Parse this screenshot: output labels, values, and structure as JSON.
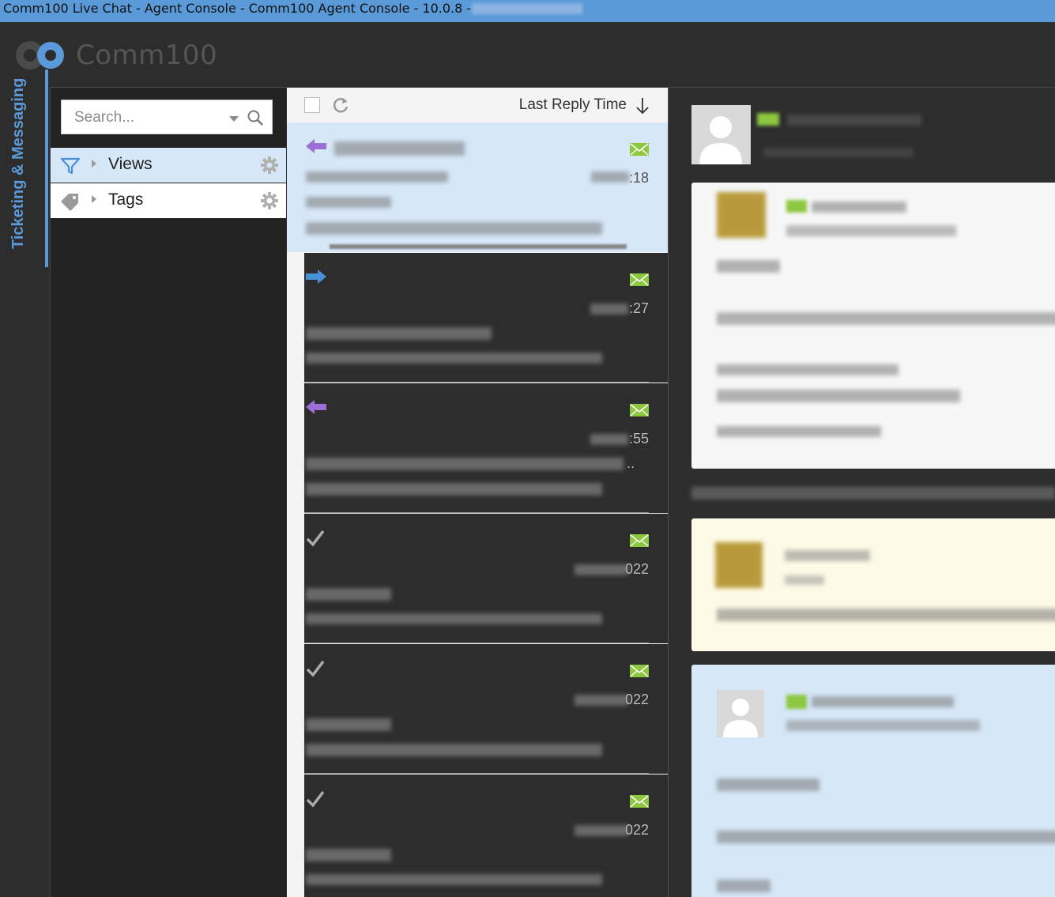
{
  "window": {
    "title": "Comm100 Live Chat - Agent Console - Comm100 Agent Console - 10.0.8 -"
  },
  "brand": {
    "name": "Comm100",
    "accent": "#5a9ad8"
  },
  "rail": {
    "label": "Ticketing & Messaging"
  },
  "nav": {
    "search_placeholder": "Search...",
    "items": [
      {
        "label": "Views",
        "icon": "filter-icon"
      },
      {
        "label": "Tags",
        "icon": "tag-icon"
      }
    ]
  },
  "list": {
    "sort_label": "Last Reply Time",
    "tickets": [
      {
        "direction": "incoming",
        "time_suffix": ":18"
      },
      {
        "direction": "outgoing",
        "time_suffix": ":27"
      },
      {
        "direction": "incoming",
        "time_suffix": ":55",
        "ellipsis": ".."
      },
      {
        "direction": "resolved",
        "time_suffix": "022"
      },
      {
        "direction": "resolved",
        "time_suffix": "022"
      },
      {
        "direction": "resolved",
        "time_suffix": "022"
      }
    ]
  },
  "colors": {
    "incoming": "#9b6fd6",
    "outgoing": "#4a90d9",
    "mail": "#8dc63f",
    "selected": "#d6e7f8",
    "note": "#fdfbe6"
  }
}
